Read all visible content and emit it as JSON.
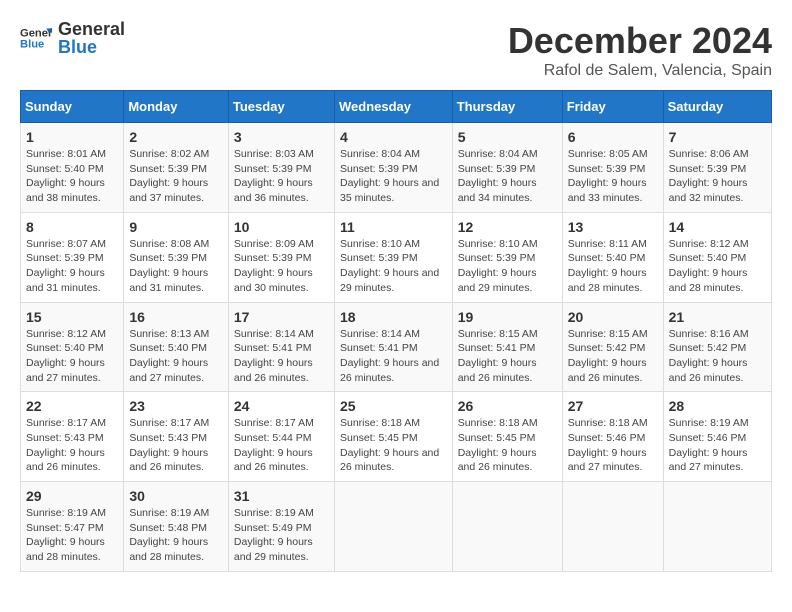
{
  "header": {
    "logo_text_general": "General",
    "logo_text_blue": "Blue",
    "main_title": "December 2024",
    "subtitle": "Rafol de Salem, Valencia, Spain"
  },
  "calendar": {
    "days_of_week": [
      "Sunday",
      "Monday",
      "Tuesday",
      "Wednesday",
      "Thursday",
      "Friday",
      "Saturday"
    ],
    "weeks": [
      [
        {
          "day": "1",
          "sunrise": "8:01 AM",
          "sunset": "5:40 PM",
          "daylight": "9 hours and 38 minutes."
        },
        {
          "day": "2",
          "sunrise": "8:02 AM",
          "sunset": "5:39 PM",
          "daylight": "9 hours and 37 minutes."
        },
        {
          "day": "3",
          "sunrise": "8:03 AM",
          "sunset": "5:39 PM",
          "daylight": "9 hours and 36 minutes."
        },
        {
          "day": "4",
          "sunrise": "8:04 AM",
          "sunset": "5:39 PM",
          "daylight": "9 hours and 35 minutes."
        },
        {
          "day": "5",
          "sunrise": "8:04 AM",
          "sunset": "5:39 PM",
          "daylight": "9 hours and 34 minutes."
        },
        {
          "day": "6",
          "sunrise": "8:05 AM",
          "sunset": "5:39 PM",
          "daylight": "9 hours and 33 minutes."
        },
        {
          "day": "7",
          "sunrise": "8:06 AM",
          "sunset": "5:39 PM",
          "daylight": "9 hours and 32 minutes."
        }
      ],
      [
        {
          "day": "8",
          "sunrise": "8:07 AM",
          "sunset": "5:39 PM",
          "daylight": "9 hours and 31 minutes."
        },
        {
          "day": "9",
          "sunrise": "8:08 AM",
          "sunset": "5:39 PM",
          "daylight": "9 hours and 31 minutes."
        },
        {
          "day": "10",
          "sunrise": "8:09 AM",
          "sunset": "5:39 PM",
          "daylight": "9 hours and 30 minutes."
        },
        {
          "day": "11",
          "sunrise": "8:10 AM",
          "sunset": "5:39 PM",
          "daylight": "9 hours and 29 minutes."
        },
        {
          "day": "12",
          "sunrise": "8:10 AM",
          "sunset": "5:39 PM",
          "daylight": "9 hours and 29 minutes."
        },
        {
          "day": "13",
          "sunrise": "8:11 AM",
          "sunset": "5:40 PM",
          "daylight": "9 hours and 28 minutes."
        },
        {
          "day": "14",
          "sunrise": "8:12 AM",
          "sunset": "5:40 PM",
          "daylight": "9 hours and 28 minutes."
        }
      ],
      [
        {
          "day": "15",
          "sunrise": "8:12 AM",
          "sunset": "5:40 PM",
          "daylight": "9 hours and 27 minutes."
        },
        {
          "day": "16",
          "sunrise": "8:13 AM",
          "sunset": "5:40 PM",
          "daylight": "9 hours and 27 minutes."
        },
        {
          "day": "17",
          "sunrise": "8:14 AM",
          "sunset": "5:41 PM",
          "daylight": "9 hours and 26 minutes."
        },
        {
          "day": "18",
          "sunrise": "8:14 AM",
          "sunset": "5:41 PM",
          "daylight": "9 hours and 26 minutes."
        },
        {
          "day": "19",
          "sunrise": "8:15 AM",
          "sunset": "5:41 PM",
          "daylight": "9 hours and 26 minutes."
        },
        {
          "day": "20",
          "sunrise": "8:15 AM",
          "sunset": "5:42 PM",
          "daylight": "9 hours and 26 minutes."
        },
        {
          "day": "21",
          "sunrise": "8:16 AM",
          "sunset": "5:42 PM",
          "daylight": "9 hours and 26 minutes."
        }
      ],
      [
        {
          "day": "22",
          "sunrise": "8:17 AM",
          "sunset": "5:43 PM",
          "daylight": "9 hours and 26 minutes."
        },
        {
          "day": "23",
          "sunrise": "8:17 AM",
          "sunset": "5:43 PM",
          "daylight": "9 hours and 26 minutes."
        },
        {
          "day": "24",
          "sunrise": "8:17 AM",
          "sunset": "5:44 PM",
          "daylight": "9 hours and 26 minutes."
        },
        {
          "day": "25",
          "sunrise": "8:18 AM",
          "sunset": "5:45 PM",
          "daylight": "9 hours and 26 minutes."
        },
        {
          "day": "26",
          "sunrise": "8:18 AM",
          "sunset": "5:45 PM",
          "daylight": "9 hours and 26 minutes."
        },
        {
          "day": "27",
          "sunrise": "8:18 AM",
          "sunset": "5:46 PM",
          "daylight": "9 hours and 27 minutes."
        },
        {
          "day": "28",
          "sunrise": "8:19 AM",
          "sunset": "5:46 PM",
          "daylight": "9 hours and 27 minutes."
        }
      ],
      [
        {
          "day": "29",
          "sunrise": "8:19 AM",
          "sunset": "5:47 PM",
          "daylight": "9 hours and 28 minutes."
        },
        {
          "day": "30",
          "sunrise": "8:19 AM",
          "sunset": "5:48 PM",
          "daylight": "9 hours and 28 minutes."
        },
        {
          "day": "31",
          "sunrise": "8:19 AM",
          "sunset": "5:49 PM",
          "daylight": "9 hours and 29 minutes."
        },
        null,
        null,
        null,
        null
      ]
    ]
  },
  "colors": {
    "header_bg": "#2176c7",
    "header_text": "#ffffff",
    "accent": "#2176c7"
  }
}
